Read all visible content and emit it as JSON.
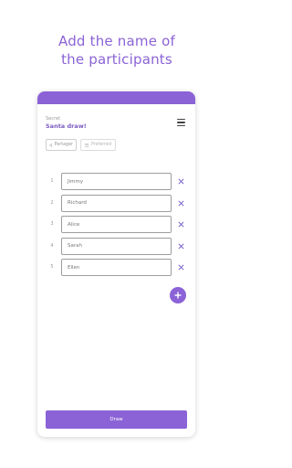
{
  "headline": {
    "line1": "Add the name of",
    "line2": "the participants"
  },
  "app": {
    "subtitle": "Secret",
    "title": "Santa draw!"
  },
  "icons": {
    "menu": "hamburger-menu-icon",
    "share": "share-icon",
    "preferences": "people-icon",
    "remove": "close-icon",
    "add": "plus-icon"
  },
  "toolbar": {
    "share_label": "Partager",
    "preferences_label": "Preferred"
  },
  "participants": [
    {
      "number": "1",
      "name": "Jimmy"
    },
    {
      "number": "2",
      "name": "Richard"
    },
    {
      "number": "3",
      "name": "Alice"
    },
    {
      "number": "4",
      "name": "Sarah"
    },
    {
      "number": "5",
      "name": "Ellen"
    }
  ],
  "draw_label": "Draw",
  "colors": {
    "accent": "#8b63d6",
    "remove_icon": "#6f55c9"
  }
}
